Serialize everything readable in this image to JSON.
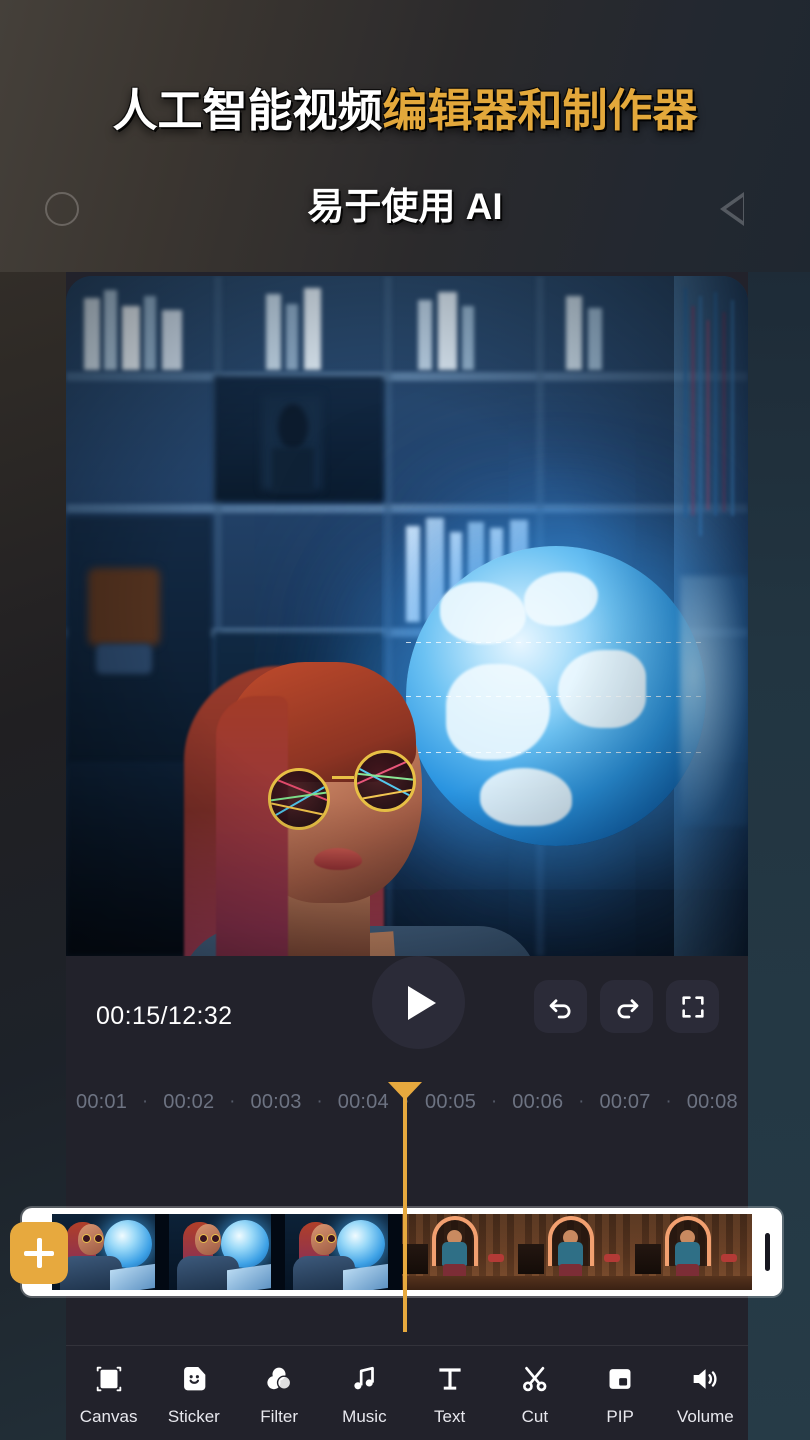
{
  "promo": {
    "title_white": "人工智能视频",
    "title_orange": "编辑器和制作器",
    "subtitle": "易于使用 AI",
    "accent_color": "#e3a83b"
  },
  "system_nav": {
    "home_icon": "circle-home-icon",
    "back_icon": "triangle-back-icon"
  },
  "preview": {
    "name": "video-preview",
    "scene_description": "woman with sunglasses beside glowing blue globe"
  },
  "controls": {
    "time_display": "00:15/12:32",
    "current_time": "00:15",
    "total_time": "12:32",
    "play_label": "play-icon",
    "buttons": [
      {
        "name": "undo-button",
        "icon": "undo-icon"
      },
      {
        "name": "redo-button",
        "icon": "redo-icon"
      },
      {
        "name": "fullscreen-button",
        "icon": "fullscreen-icon"
      }
    ]
  },
  "timeline": {
    "ruler_ticks": [
      "00:01",
      "00:02",
      "00:03",
      "00:04",
      "00:05",
      "00:06",
      "00:07",
      "00:08"
    ],
    "separator": "·",
    "playhead_color": "#e7a93e",
    "playhead_position": "00:04",
    "add_clip_label": "+",
    "clips": [
      {
        "name": "clip-blue",
        "tone": "blue"
      },
      {
        "name": "clip-warm",
        "tone": "warm"
      }
    ]
  },
  "toolbar": {
    "items": [
      {
        "label": "Canvas",
        "icon": "canvas-icon"
      },
      {
        "label": "Sticker",
        "icon": "sticker-icon"
      },
      {
        "label": "Filter",
        "icon": "filter-icon"
      },
      {
        "label": "Music",
        "icon": "music-icon"
      },
      {
        "label": "Text",
        "icon": "text-icon"
      },
      {
        "label": "Cut",
        "icon": "scissors-icon"
      },
      {
        "label": "PIP",
        "icon": "pip-icon"
      },
      {
        "label": "Volume",
        "icon": "volume-icon"
      }
    ]
  }
}
